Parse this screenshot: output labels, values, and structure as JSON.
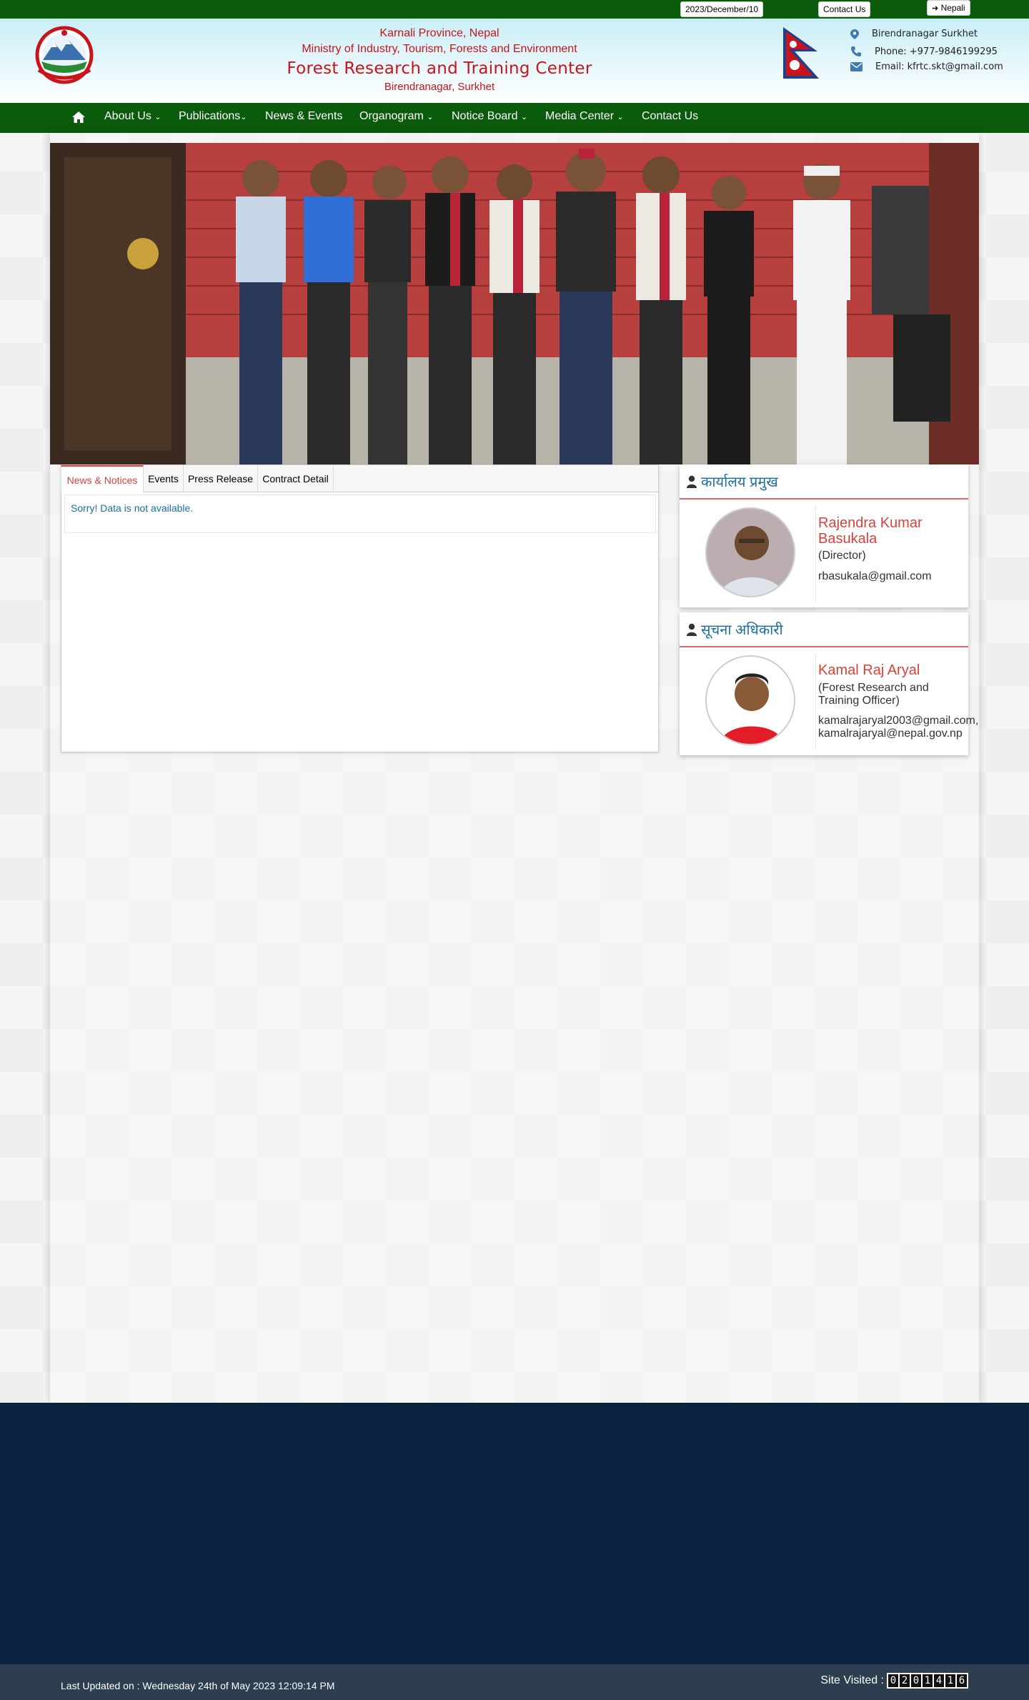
{
  "topbar": {
    "date": "2023/December/10",
    "contact": "Contact Us",
    "language": "Nepali"
  },
  "header": {
    "province": "Karnali Province, Nepal",
    "ministry": "Ministry of Industry, Tourism, Forests and Environment",
    "title": "Forest Research and Training Center",
    "location": "Birendranagar, Surkhet",
    "address": "Birendranagar Surkhet",
    "phone": "Phone: +977-9846199295",
    "email": "Email: kfrtc.skt@gmail.com"
  },
  "nav": {
    "items": [
      {
        "label": "About Us",
        "dropdown": true
      },
      {
        "label": "Publications",
        "dropdown": true
      },
      {
        "label": "News & Events",
        "dropdown": false
      },
      {
        "label": "Organogram",
        "dropdown": true
      },
      {
        "label": "Notice Board",
        "dropdown": true
      },
      {
        "label": "Media Center",
        "dropdown": true
      },
      {
        "label": "Contact Us",
        "dropdown": false
      }
    ]
  },
  "tabs": {
    "items": [
      "News & Notices",
      "Events",
      "Press Release",
      "Contract Detail"
    ],
    "active": "News & Notices",
    "empty_message": "Sorry! Data is not available."
  },
  "officials": [
    {
      "heading": "कार्यालय प्रमुख",
      "name": "Rajendra Kumar Basukala",
      "position": "(Director)",
      "email": "rbasukala@gmail.com"
    },
    {
      "heading": "सूचना अधिकारी",
      "name": "Kamal Raj Aryal",
      "position": "(Forest Research and Training Officer)",
      "email": "kamalrajaryal2003@gmail.com, kamalrajaryal@nepal.gov.np"
    }
  ],
  "footer": {
    "last_updated": "Last Updated on : Wednesday 24th of May 2023 12:09:14 PM",
    "site_visited_label": "Site Visited :",
    "visit_count": "0201416"
  },
  "colors": {
    "topbar_green": "#0a5b0b",
    "header_red": "#c8141b",
    "accent_red": "#d9423a",
    "link_blue": "#1a6ea0",
    "footer_navy": "#0b2340"
  }
}
